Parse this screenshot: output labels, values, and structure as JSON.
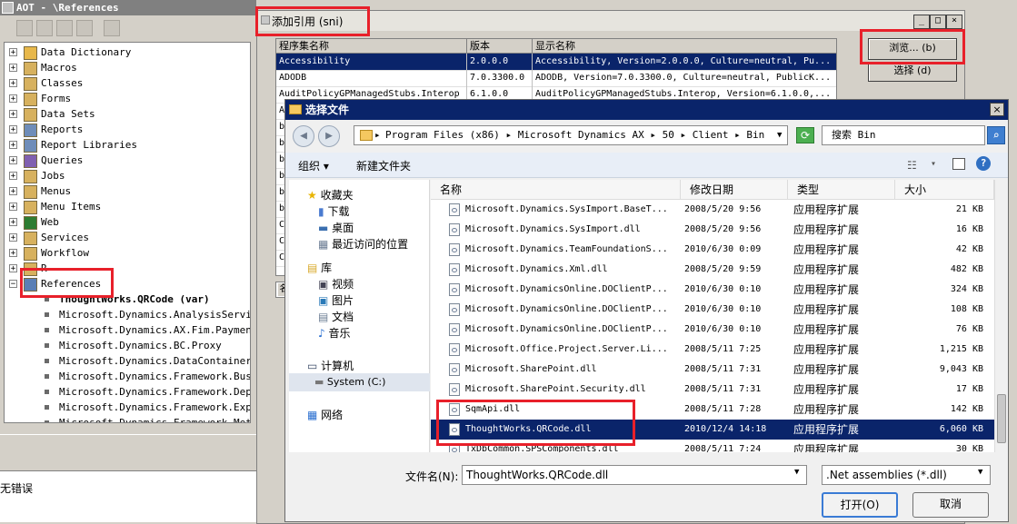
{
  "aot": {
    "title": "AOT - \\References",
    "tree": [
      {
        "label": "Data Dictionary",
        "icon": "data-dictionary-icon",
        "color": "#e8b84a"
      },
      {
        "label": "Macros",
        "icon": "macros-icon",
        "color": "#d7b15e"
      },
      {
        "label": "Classes",
        "icon": "classes-icon",
        "color": "#d7b15e"
      },
      {
        "label": "Forms",
        "icon": "forms-icon",
        "color": "#d7b15e"
      },
      {
        "label": "Data Sets",
        "icon": "datasets-icon",
        "color": "#d7b15e"
      },
      {
        "label": "Reports",
        "icon": "reports-icon",
        "color": "#6f8db9"
      },
      {
        "label": "Report Libraries",
        "icon": "report-libraries-icon",
        "color": "#6f8db9"
      },
      {
        "label": "Queries",
        "icon": "queries-icon",
        "color": "#8060b0"
      },
      {
        "label": "Jobs",
        "icon": "jobs-icon",
        "color": "#d7b15e"
      },
      {
        "label": "Menus",
        "icon": "menus-icon",
        "color": "#d7b15e"
      },
      {
        "label": "Menu Items",
        "icon": "menu-items-icon",
        "color": "#d7b15e"
      },
      {
        "label": "Web",
        "icon": "web-icon",
        "color": "#2e7d32"
      },
      {
        "label": "Services",
        "icon": "services-icon",
        "color": "#d7b15e"
      },
      {
        "label": "Workflow",
        "icon": "workflow-icon",
        "color": "#d7b15e"
      },
      {
        "label": "R",
        "icon": "folder-icon",
        "color": "#d7b15e"
      },
      {
        "label": "References",
        "icon": "references-icon",
        "color": "#5a7fb5"
      }
    ],
    "references": [
      "ThoughtWorks.QRCode (var)",
      "Microsoft.Dynamics.AnalysisServices",
      "Microsoft.Dynamics.AX.Fim.PaymentSe",
      "Microsoft.Dynamics.BC.Proxy",
      "Microsoft.Dynamics.DataContainer",
      "Microsoft.Dynamics.Framework.Busine",
      "Microsoft.Dynamics.Framework.Deploy",
      "Microsoft.Dynamics.Framework.Expres",
      "Microsoft.Dynamics.Framework.Metada"
    ],
    "status_text": "无错误"
  },
  "add_reference": {
    "title": "添加引用 (sni)",
    "columns": [
      "程序集名称",
      "版本",
      "显示名称"
    ],
    "rows": [
      {
        "name": "Accessibility",
        "version": "2.0.0.0",
        "display": "Accessibility, Version=2.0.0.0, Culture=neutral, Pu..."
      },
      {
        "name": "ADODB",
        "version": "7.0.3300.0",
        "display": "ADODB, Version=7.0.3300.0, Culture=neutral, PublicK..."
      },
      {
        "name": "AuditPolicyGPManagedStubs.Interop",
        "version": "6.1.0.0",
        "display": "AuditPolicyGPManagedStubs.Interop, Version=6.1.0.0,..."
      },
      {
        "name": "A",
        "version": "",
        "display": ""
      },
      {
        "name": "b",
        "version": "",
        "display": ""
      },
      {
        "name": "b",
        "version": "",
        "display": ""
      },
      {
        "name": "b",
        "version": "",
        "display": ""
      },
      {
        "name": "b",
        "version": "",
        "display": ""
      },
      {
        "name": "b",
        "version": "",
        "display": ""
      },
      {
        "name": "b",
        "version": "",
        "display": ""
      },
      {
        "name": "C",
        "version": "",
        "display": ""
      },
      {
        "name": "C",
        "version": "",
        "display": ""
      },
      {
        "name": "C",
        "version": "",
        "display": ""
      }
    ],
    "browse_label": "浏览... (b)",
    "select_label": "选择 (d)",
    "lower_col": "名"
  },
  "file_dialog": {
    "title": "选择文件",
    "path": [
      "Program Files (x86)",
      "Microsoft Dynamics AX",
      "50",
      "Client",
      "Bin"
    ],
    "search_placeholder": "搜索 Bin",
    "organize_label": "组织",
    "new_folder_label": "新建文件夹",
    "nav": {
      "favorites": "收藏夹",
      "downloads": "下载",
      "desktop": "桌面",
      "recent": "最近访问的位置",
      "libraries": "库",
      "videos": "视频",
      "pictures": "图片",
      "documents": "文档",
      "music": "音乐",
      "computer": "计算机",
      "system_drive": "System (C:)",
      "network": "网络"
    },
    "columns": [
      "名称",
      "修改日期",
      "类型",
      "大小"
    ],
    "files": [
      {
        "name": "Microsoft.Dynamics.SysImport.BaseT...",
        "date": "2008/5/20 9:56",
        "type": "应用程序扩展",
        "size": "21 KB"
      },
      {
        "name": "Microsoft.Dynamics.SysImport.dll",
        "date": "2008/5/20 9:56",
        "type": "应用程序扩展",
        "size": "16 KB"
      },
      {
        "name": "Microsoft.Dynamics.TeamFoundationS...",
        "date": "2010/6/30 0:09",
        "type": "应用程序扩展",
        "size": "42 KB"
      },
      {
        "name": "Microsoft.Dynamics.Xml.dll",
        "date": "2008/5/20 9:59",
        "type": "应用程序扩展",
        "size": "482 KB"
      },
      {
        "name": "Microsoft.DynamicsOnline.DOClientP...",
        "date": "2010/6/30 0:10",
        "type": "应用程序扩展",
        "size": "324 KB"
      },
      {
        "name": "Microsoft.DynamicsOnline.DOClientP...",
        "date": "2010/6/30 0:10",
        "type": "应用程序扩展",
        "size": "108 KB"
      },
      {
        "name": "Microsoft.DynamicsOnline.DOClientP...",
        "date": "2010/6/30 0:10",
        "type": "应用程序扩展",
        "size": "76 KB"
      },
      {
        "name": "Microsoft.Office.Project.Server.Li...",
        "date": "2008/5/11 7:25",
        "type": "应用程序扩展",
        "size": "1,215 KB"
      },
      {
        "name": "Microsoft.SharePoint.dll",
        "date": "2008/5/11 7:31",
        "type": "应用程序扩展",
        "size": "9,043 KB"
      },
      {
        "name": "Microsoft.SharePoint.Security.dll",
        "date": "2008/5/11 7:31",
        "type": "应用程序扩展",
        "size": "17 KB"
      },
      {
        "name": "SqmApi.dll",
        "date": "2008/5/11 7:28",
        "type": "应用程序扩展",
        "size": "142 KB"
      },
      {
        "name": "ThoughtWorks.QRCode.dll",
        "date": "2010/12/4 14:18",
        "type": "应用程序扩展",
        "size": "6,060 KB",
        "selected": true
      },
      {
        "name": "TxDbCommon.SPSComponents.dll",
        "date": "2008/5/11 7:24",
        "type": "应用程序扩展",
        "size": "30 KB"
      }
    ],
    "filename_label": "文件名(N):",
    "filename_value": "ThoughtWorks.QRCode.dll",
    "filetype_value": ".Net assemblies (*.dll)",
    "open_label": "打开(O)",
    "cancel_label": "取消"
  },
  "colors": {
    "selection": "#0a246a",
    "highlight_box": "#e8202a"
  }
}
